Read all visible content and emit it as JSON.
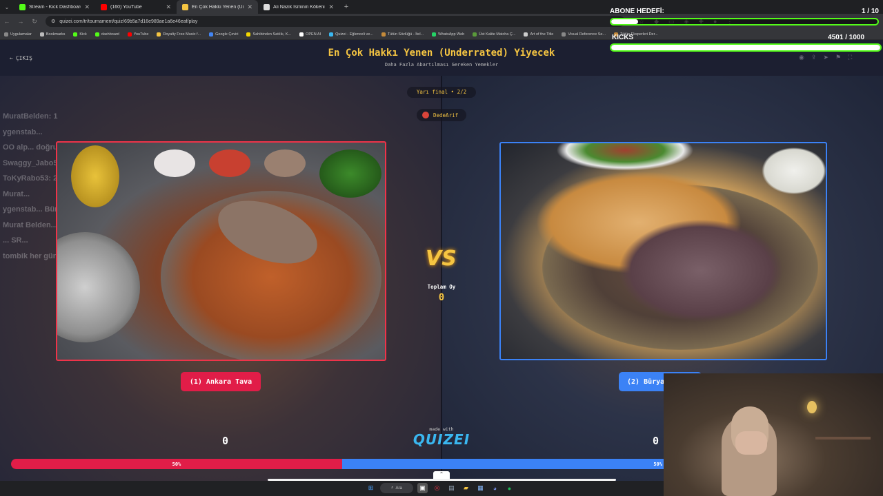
{
  "browser": {
    "tabs": [
      {
        "title": "Stream - Kick Dashboard",
        "color": "#53fc18",
        "active": false
      },
      {
        "title": "(160) YouTube",
        "color": "#ff0000",
        "active": false
      },
      {
        "title": "En Çok Hakkı Yenen (Underrate",
        "color": "#f5c542",
        "active": true
      },
      {
        "title": "Ali Nazik İsminin Kökeni",
        "color": "#dddddd",
        "active": false
      }
    ],
    "url": "quizei.com/tr/tournament/quiz/69b5a7d16e989ae1a6e46eaf/play",
    "bookmarks": [
      {
        "label": "Uygulamalar",
        "color": "#888888"
      },
      {
        "label": "Bookmarks",
        "color": "#bbbbbb"
      },
      {
        "label": "Kick",
        "color": "#53fc18"
      },
      {
        "label": "dashboard",
        "color": "#53fc18"
      },
      {
        "label": "YouTube",
        "color": "#ff0000"
      },
      {
        "label": "Royalty Free Music f...",
        "color": "#f5c542"
      },
      {
        "label": "Google Çeviri",
        "color": "#4285f4"
      },
      {
        "label": "Sahibinden Satılık, K...",
        "color": "#f5d800"
      },
      {
        "label": "OPEN AI",
        "color": "#ffffff"
      },
      {
        "label": "Quizei - Eğlenceli ve...",
        "color": "#3ab7f0"
      },
      {
        "label": "Tütün Sözlüğü - İtel...",
        "color": "#c48a3a"
      },
      {
        "label": "WhatsApp Web",
        "color": "#25d366"
      },
      {
        "label": "Üst Kalite Matcha Ç...",
        "color": "#5a9a3a"
      },
      {
        "label": "Art of the Title",
        "color": "#cccccc"
      },
      {
        "label": "Visual Reference Se...",
        "color": "#888888"
      },
      {
        "label": "Tütün Eksperleri Der...",
        "color": "#c48a3a"
      }
    ]
  },
  "page": {
    "exit_label": "ÇIKIŞ",
    "title": "En Çok Hakkı Yenen (Underrated) Yiyecek",
    "subtitle": "Daha Fazla Abartılması Gereken Yemekler",
    "round": "Yarı final • 2/2",
    "user": "DedeArif",
    "vs": "VS",
    "total_label": "Toplam Oy",
    "total_value": "0",
    "left": {
      "label": "(1) Ankara Tava",
      "votes": "0",
      "percent_label": "50%",
      "share": 0.5
    },
    "right": {
      "label": "(2) Büryan",
      "votes": "0",
      "percent_label": "50%",
      "share": 0.5
    },
    "made_with": "made with",
    "logo": "QUIZEI"
  },
  "chat_lines": [
    "MuratBelden: 1",
    "ygenstab...",
    "OO alp... doğru",
    "Swaggy_Jabo53: 2",
    "ToKyRabo53: 2",
    "Murat...",
    "ygenstab... Büryan...",
    "Murat Belden...",
    "... SR...",
    "tombik her gün..."
  ],
  "overlay": {
    "goal_title": "ABONE HEDEFİ:",
    "goal_count": "1 / 10",
    "goal_progress": 0.1,
    "kicks_title": "KICKS",
    "kicks_count": "4501 / 1000",
    "kicks_progress": 1.0
  },
  "taskbar": {
    "search_label": "Ara"
  },
  "colors": {
    "accent_yellow": "#f5c542",
    "left_red": "#e11d48",
    "right_blue": "#3b82f6",
    "kick_green": "#53fc18"
  }
}
